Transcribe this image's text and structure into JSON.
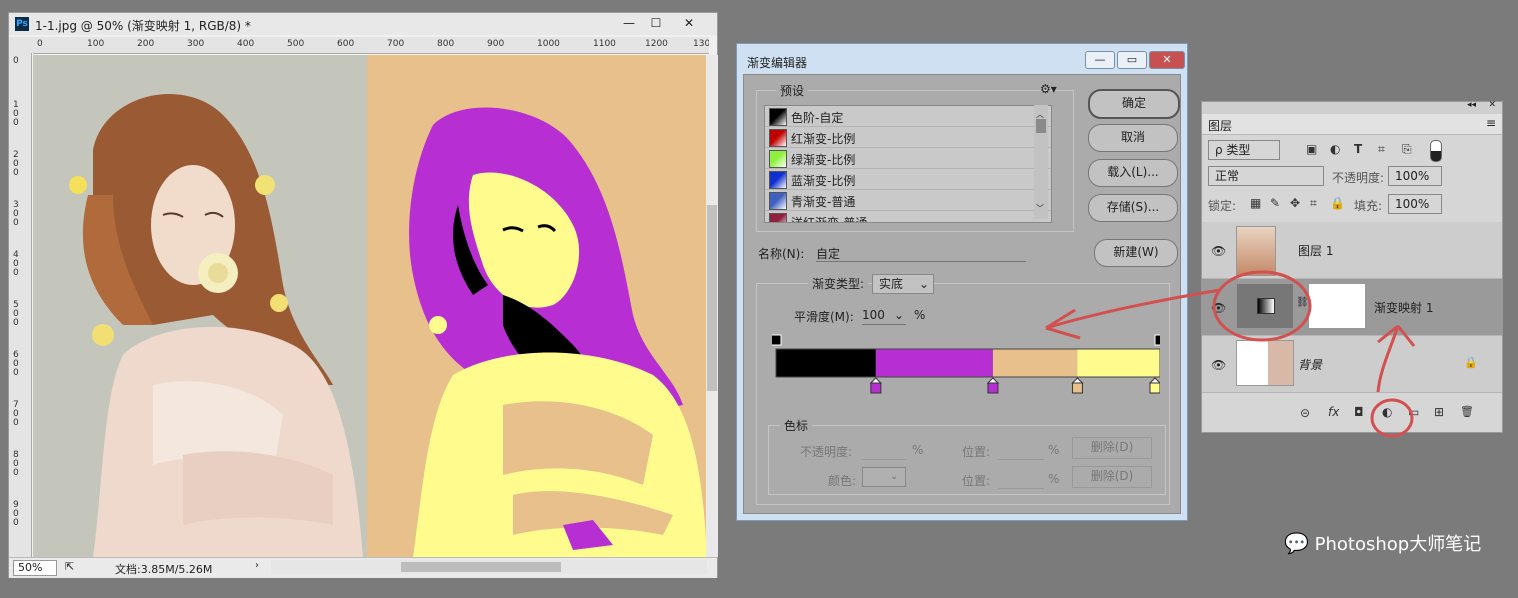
{
  "document": {
    "title": "1-1.jpg @ 50% (渐变映射 1, RGB/8) *",
    "ps_logo": "Ps",
    "win_controls": [
      "—",
      "☐",
      "✕"
    ],
    "ruler_h": [
      "0",
      "100",
      "200",
      "300",
      "400",
      "500",
      "600",
      "700",
      "800",
      "900",
      "1000",
      "1100",
      "1200",
      "130"
    ],
    "ruler_v": [
      "0",
      "100",
      "200",
      "300",
      "400",
      "500",
      "600",
      "700",
      "800",
      "900"
    ],
    "zoom": "50%",
    "doc_info": "文档:3.85M/5.26M",
    "posterize_colors": [
      "#000000",
      "#b72fd2",
      "#e8c08c",
      "#fffb8c"
    ]
  },
  "gradient_editor": {
    "title": "渐变编辑器",
    "presets_label": "预设",
    "gear_icon": "gear-icon",
    "presets": [
      {
        "label": "色阶-自定",
        "c1": "#000000",
        "c2": "#ffffff"
      },
      {
        "label": " 红渐变-比例",
        "c1": "#c00000",
        "c2": "#ffffff"
      },
      {
        "label": "绿渐变-比例",
        "c1": "#90f040",
        "c2": "#ffffff"
      },
      {
        "label": "蓝渐变-比例",
        "c1": "#1030d0",
        "c2": "#ffffff"
      },
      {
        "label": "青渐变-普通",
        "c1": "#4060c0",
        "c2": "#ffffff"
      },
      {
        "label": "洋红渐变-普通",
        "c1": "#902040",
        "c2": "#ffffff"
      }
    ],
    "buttons": {
      "ok": "确定",
      "cancel": "取消",
      "load": "载入(L)...",
      "save": "存储(S)...",
      "new": "新建(W)"
    },
    "name_label": "名称(N):",
    "name_value": "自定",
    "type_label": "渐变类型:",
    "type_value": "实底",
    "smooth_label": "平滑度(M):",
    "smooth_value": "100",
    "smooth_unit": "%",
    "stops_group": "色标",
    "opacity_label": "不透明度:",
    "color_label": "颜色:",
    "position_label": "位置:",
    "percent": "%",
    "delete_label": "删除(D)",
    "gradient_segments": [
      {
        "color": "#000000",
        "from": 0,
        "to": 0.26
      },
      {
        "color": "#b72fd2",
        "from": 0.26,
        "to": 0.565
      },
      {
        "color": "#e8c08c",
        "from": 0.565,
        "to": 0.785
      },
      {
        "color": "#fffb8c",
        "from": 0.785,
        "to": 1
      }
    ],
    "color_stop_positions": [
      0.26,
      0.565,
      0.785,
      1
    ]
  },
  "layers": {
    "tab": "图层",
    "filter_kind": "ρ 类型",
    "blend_mode": "正常",
    "opacity_label": "不透明度:",
    "opacity_value": "100%",
    "lock_label": "锁定:",
    "fill_label": "填充:",
    "fill_value": "100%",
    "items": [
      {
        "name": "图层 1"
      },
      {
        "name": "渐变映射 1"
      },
      {
        "name": "背景"
      }
    ],
    "bottom_icons": [
      "⊝",
      "fx",
      "◘",
      "◐",
      "▭",
      "⊞",
      "🗑"
    ]
  },
  "watermark": "Photoshop大师笔记"
}
